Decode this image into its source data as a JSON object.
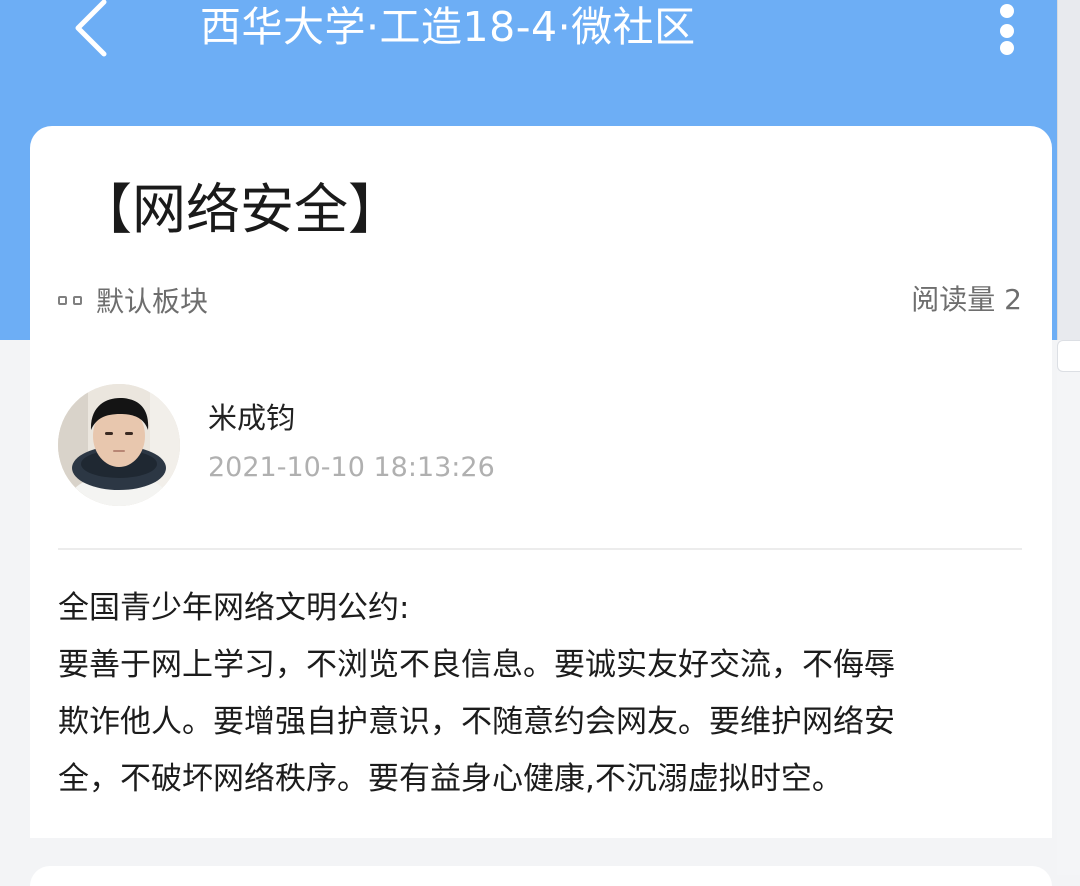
{
  "header": {
    "title": "西华大学·工造18-4·微社区",
    "back_icon": "chevron-left-icon",
    "more_icon": "more-vertical-icon"
  },
  "post": {
    "title": "【网络安全】",
    "board": "默认板块",
    "read_count": "阅读量 2",
    "author": {
      "name": "米成钧",
      "time": "2021-10-10 18:13:26"
    },
    "content": [
      "全国青少年网络文明公约:",
      "要善于网上学习，不浏览不良信息。要诚实友好交流，不侮辱",
      "欺诈他人。要增强自护意识，不随意约会网友。要维护网络安",
      "全，不破坏网络秩序。要有益身心健康,不沉溺虚拟时空。"
    ]
  },
  "colors": {
    "header_bg": "#6daef5",
    "page_bg": "#f3f4f6",
    "card_bg": "#ffffff",
    "muted_text": "#6e6e6e",
    "time_text": "#b0b0b0"
  }
}
